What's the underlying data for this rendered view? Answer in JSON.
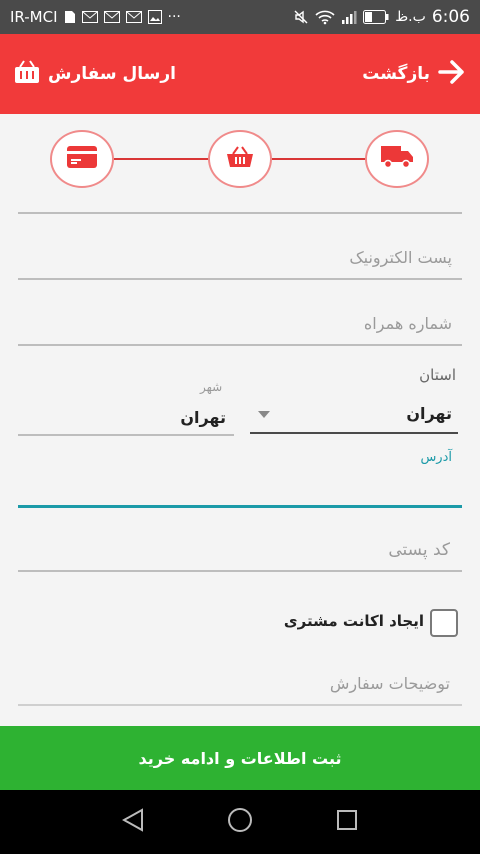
{
  "status_bar": {
    "carrier": "IR-MCI",
    "time": "6:06",
    "ampm": "ب.ظ",
    "notification_icons": [
      "sim-icon",
      "mail-icon",
      "mail-icon",
      "mail-icon",
      "image-icon",
      "more-icon"
    ],
    "system_icons": [
      "mute-icon",
      "wifi-icon",
      "signal-icon",
      "battery-icon"
    ]
  },
  "header": {
    "back_label": "بازگشت",
    "title": "ارسال سفارش",
    "color": "#f13a3a"
  },
  "steps": [
    {
      "name": "payment",
      "icon": "credit-card-icon"
    },
    {
      "name": "cart",
      "icon": "basket-icon"
    },
    {
      "name": "shipping",
      "icon": "truck-icon"
    }
  ],
  "form": {
    "email_label": "پست الکترونیک",
    "phone_label": "شماره همراه",
    "province_label": "استان",
    "province_value": "تهران",
    "city_label": "شهر",
    "city_value": "تهران",
    "address_label": "آدرس",
    "postal_label": "کد پستی",
    "create_account_label": "ایجاد اکانت مشتری",
    "notes_label": "توضیحات سفارش"
  },
  "submit_label": "ثبت اطلاعات و ادامه خرید",
  "colors": {
    "accent": "#f13a3a",
    "success": "#2eb232",
    "focus": "#1b9aa8"
  }
}
